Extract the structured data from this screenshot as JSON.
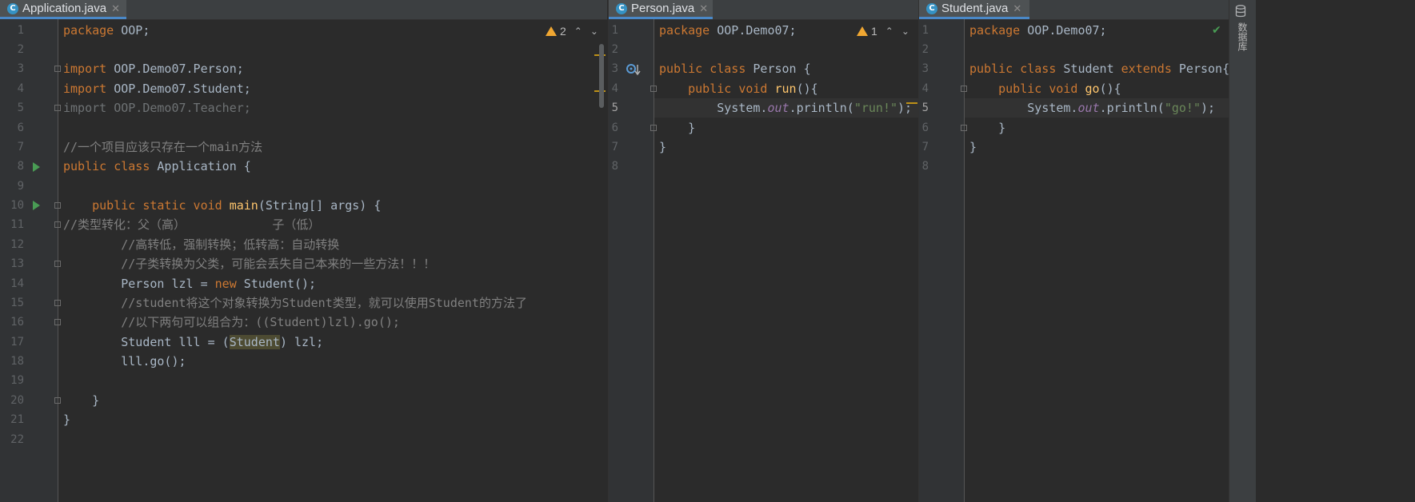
{
  "panes": [
    {
      "tab": "Application.java",
      "tab_icon": "C",
      "warning_count": "2",
      "lines": [
        "1",
        "2",
        "3",
        "4",
        "5",
        "6",
        "7",
        "8",
        "9",
        "10",
        "11",
        "12",
        "13",
        "14",
        "15",
        "16",
        "17",
        "18",
        "19",
        "20",
        "21",
        "22"
      ]
    },
    {
      "tab": "Person.java",
      "tab_icon": "C",
      "warning_count": "1",
      "lines": [
        "1",
        "2",
        "3",
        "4",
        "5",
        "6",
        "7",
        "8"
      ]
    },
    {
      "tab": "Student.java",
      "tab_icon": "C",
      "lines": [
        "1",
        "2",
        "3",
        "4",
        "5",
        "6",
        "7",
        "8"
      ]
    }
  ],
  "code": {
    "app": {
      "l1": [
        "package",
        " OOP;"
      ],
      "l3": [
        "import",
        " OOP.Demo07.Person;"
      ],
      "l4": [
        "import",
        " OOP.Demo07.Student;"
      ],
      "l5": "import OOP.Demo07.Teacher;",
      "l7": "//一个项目应该只存在一个main方法",
      "l8": [
        "public class",
        " Application {"
      ],
      "l10": [
        "    public static void",
        " main",
        "(String[] args) {"
      ],
      "l11": "//类型转化：父（高）            子（低）",
      "l12": "        //高转低，强制转换；低转高：自动转换",
      "l13": "        //子类转换为父类，可能会丢失自己本来的一些方法！！！",
      "l14": [
        "        Person lzl = ",
        "new",
        " Student();"
      ],
      "l15": "        //student将这个对象转换为Student类型，就可以使用Student的方法了",
      "l16": "        //以下两句可以组合为：((Student)lzl).go();",
      "l17": [
        "        Student lll = (",
        "Student",
        ") lzl;"
      ],
      "l18": "        lll.go();",
      "l20": "    }",
      "l21": "}"
    },
    "person": {
      "l1": [
        "package",
        " OOP.Demo07;"
      ],
      "l3": [
        "public class",
        " Person {"
      ],
      "l4": [
        "    public void",
        " run",
        "(){"
      ],
      "l5": [
        "        System.",
        "out",
        ".println(",
        "\"run!\"",
        ");"
      ],
      "l6": "    }",
      "l7": "}"
    },
    "student": {
      "l1": [
        "package",
        " OOP.Demo07;"
      ],
      "l3": [
        "public class",
        " Student ",
        "extends",
        " Person{"
      ],
      "l4": [
        "    public void",
        " go",
        "(){"
      ],
      "l5": [
        "        System.",
        "out",
        ".println(",
        "\"go!\"",
        ");"
      ],
      "l6": "    }",
      "l7": "}"
    }
  },
  "sidebar_label": "数据库",
  "colors": {
    "background": "#2b2b2b",
    "keyword": "#cc7832",
    "comment": "#808080",
    "string": "#6a8759",
    "method": "#ffc66d",
    "static_field": "#9876aa",
    "warning": "#f0a732",
    "run_icon": "#499c54"
  }
}
